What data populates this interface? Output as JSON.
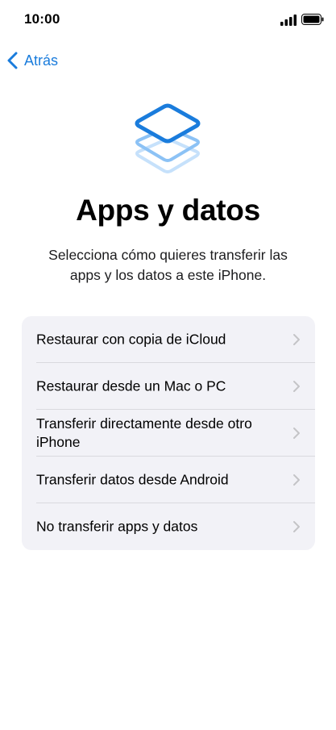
{
  "status_bar": {
    "time": "10:00",
    "icons": [
      "signal-icon",
      "battery-icon"
    ]
  },
  "nav": {
    "back_label": "Atrás",
    "back_icon": "chevron-left-icon"
  },
  "hero": {
    "icon": "stacked-layers-icon",
    "title": "Apps y datos",
    "subtitle": "Selecciona cómo quieres transferir las apps y los datos a este iPhone."
  },
  "options": [
    {
      "label": "Restaurar con copia de iCloud"
    },
    {
      "label": "Restaurar desde un Mac o PC"
    },
    {
      "label": "Transferir directamente desde otro iPhone"
    },
    {
      "label": "Transferir datos desde Android"
    },
    {
      "label": "No transferir apps y datos"
    }
  ],
  "colors": {
    "accent": "#1a7cdc",
    "list_background": "#f2f2f7",
    "chevron": "#c4c4c7"
  }
}
